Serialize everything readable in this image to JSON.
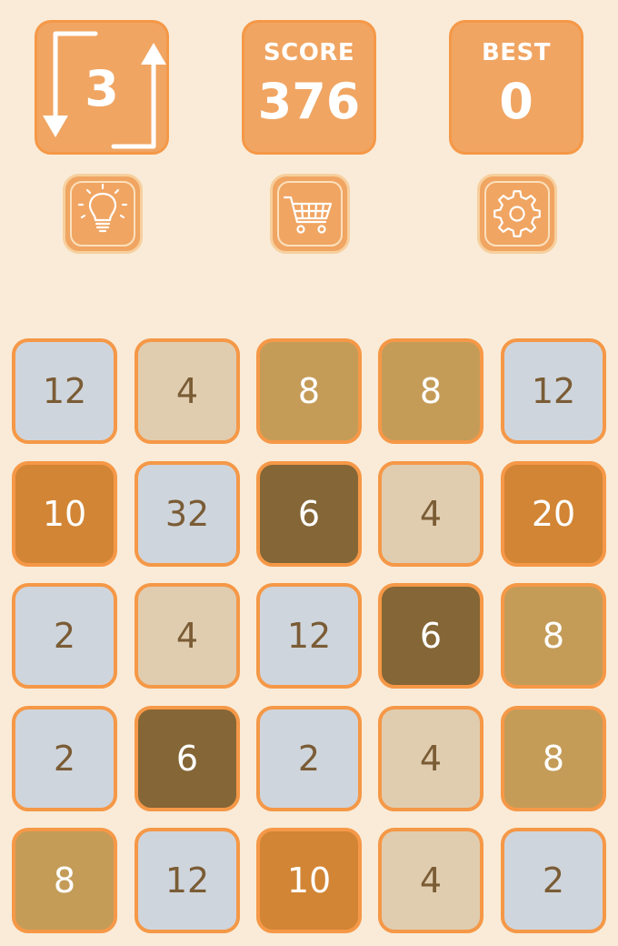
{
  "moves": {
    "value": "3",
    "icon": "swap-arrows-icon"
  },
  "score": {
    "label": "SCORE",
    "value": "376"
  },
  "best": {
    "label": "BEST",
    "value": "0"
  },
  "toolbar": {
    "hint_icon": "lightbulb-icon",
    "shop_icon": "shopping-cart-icon",
    "settings_icon": "gear-icon"
  },
  "colors": {
    "background": "#f9ebd7",
    "accent": "#f0a562",
    "tile_border": "#f59847"
  },
  "tile_styles": {
    "2": {
      "bg": "#cfd5dc",
      "fg": "#7a5c35"
    },
    "4": {
      "bg": "#e0cdb0",
      "fg": "#7a5c35"
    },
    "6": {
      "bg": "#856636",
      "fg": "#ffffff"
    },
    "8": {
      "bg": "#c49c58",
      "fg": "#ffffff"
    },
    "10": {
      "bg": "#d28534",
      "fg": "#ffffff"
    },
    "12": {
      "bg": "#cfd5dc",
      "fg": "#7a5c35"
    },
    "20": {
      "bg": "#d28534",
      "fg": "#ffffff"
    },
    "32": {
      "bg": "#cfd5dc",
      "fg": "#7a5c35"
    }
  },
  "board": [
    [
      "12",
      "4",
      "8",
      "8",
      "12"
    ],
    [
      "10",
      "32",
      "6",
      "4",
      "20"
    ],
    [
      "2",
      "4",
      "12",
      "6",
      "8"
    ],
    [
      "2",
      "6",
      "2",
      "4",
      "8"
    ],
    [
      "8",
      "12",
      "10",
      "4",
      "2"
    ]
  ]
}
